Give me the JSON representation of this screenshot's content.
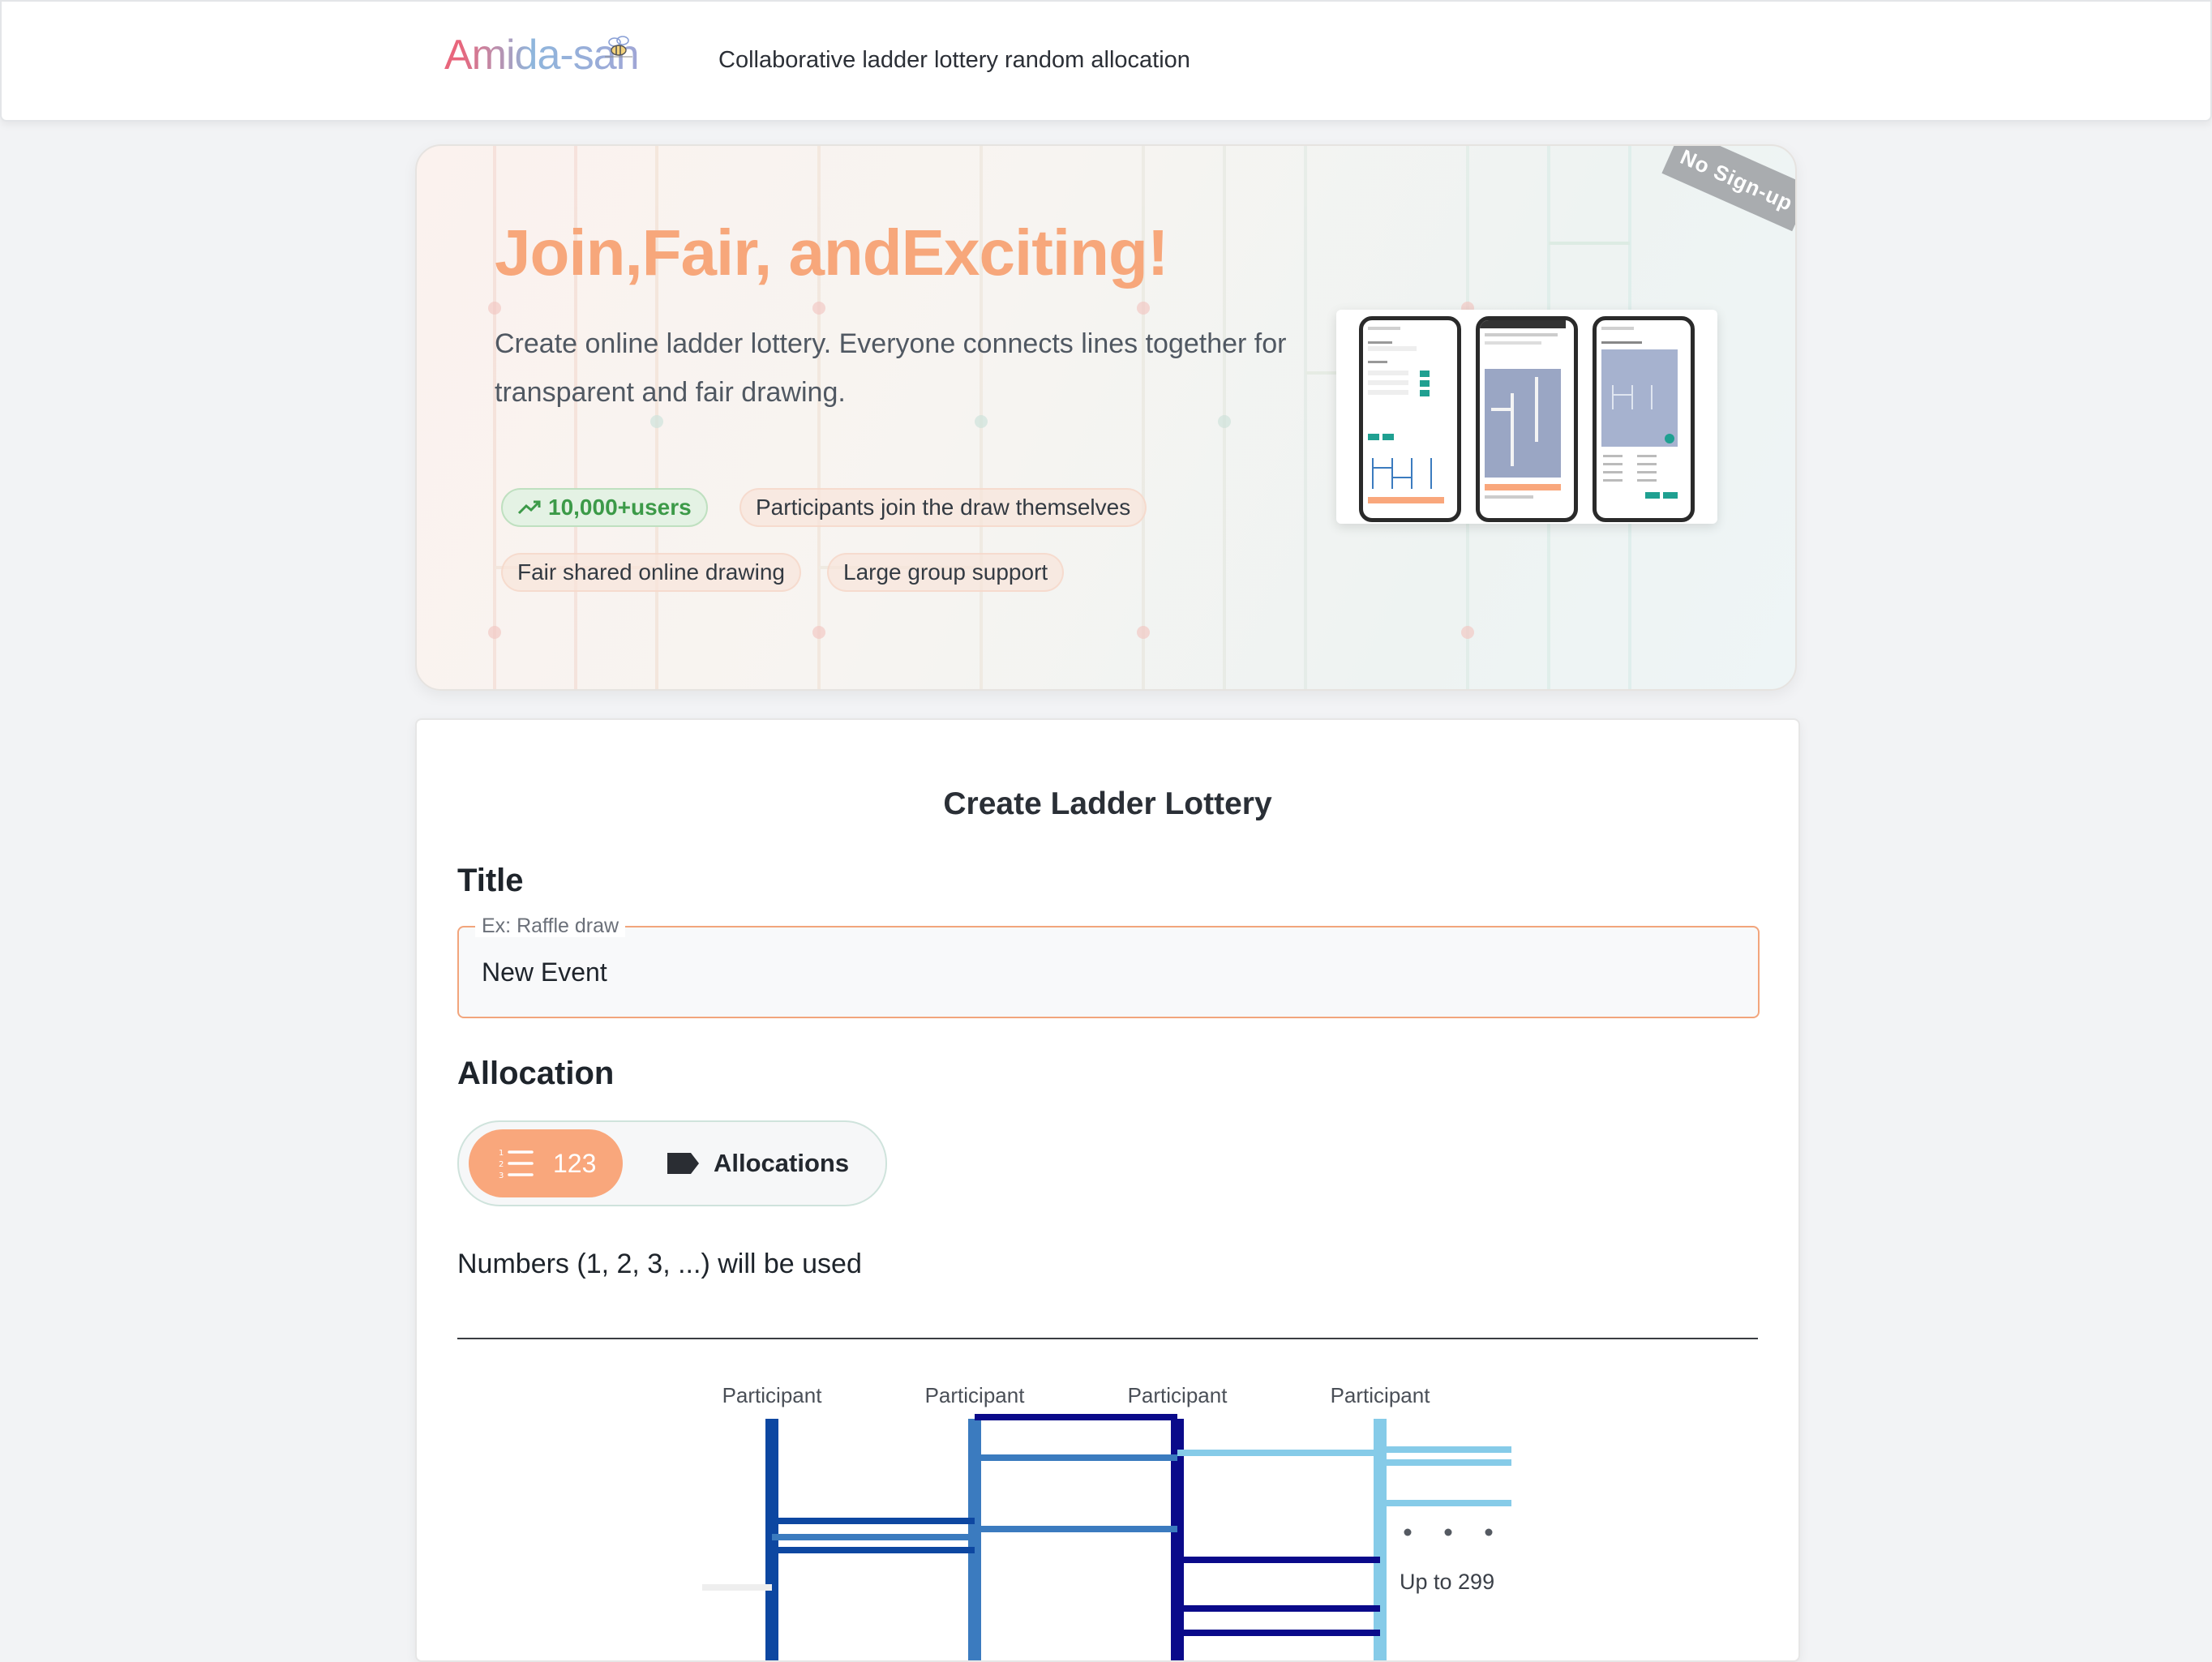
{
  "header": {
    "logo_text": "Amida-san",
    "tagline": "Collaborative ladder lottery random allocation"
  },
  "hero": {
    "title": "Join,Fair, andExciting!",
    "description": "Create online ladder lottery. Everyone connects lines together for transparent and fair drawing.",
    "ribbon": "No Sign-up",
    "chips": [
      {
        "label": "10,000+users",
        "icon": "trending-up-icon"
      },
      {
        "label": "Participants join the draw themselves"
      },
      {
        "label": "Fair shared online drawing"
      },
      {
        "label": "Large group support"
      }
    ],
    "screenshots_alt": "app screenshots"
  },
  "form": {
    "card_title": "Create Ladder Lottery",
    "title_label": "Title",
    "title_placeholder": "Ex: Raffle draw",
    "title_value": "New Event",
    "allocation_label": "Allocation",
    "toggle": {
      "numbers_label": "123",
      "numbers_icon": "numbered-list-icon",
      "allocations_label": "Allocations",
      "allocations_icon": "tag-icon",
      "selected": "123"
    },
    "hint": "Numbers (1, 2, 3, ...) will be used"
  },
  "preview": {
    "participants": [
      "Participant",
      "Participant",
      "Participant",
      "Participant"
    ],
    "more_label": "Up to 299"
  },
  "colors": {
    "accent": "#f9a77c",
    "hero_title": "#f7a77b",
    "green_chip": "#3c9a48",
    "ladder_lines": [
      "#0d47a1",
      "#3b7bbf",
      "#0a0a8a",
      "#86cbe8"
    ]
  }
}
